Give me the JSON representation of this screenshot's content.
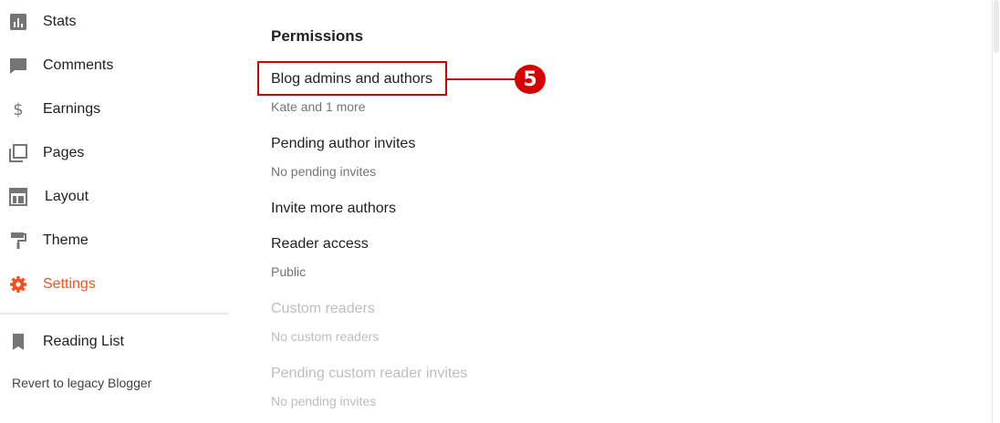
{
  "sidebar": {
    "items": [
      {
        "label": "Stats",
        "icon": "bar-chart-icon"
      },
      {
        "label": "Comments",
        "icon": "comment-icon"
      },
      {
        "label": "Earnings",
        "icon": "dollar-icon"
      },
      {
        "label": "Pages",
        "icon": "pages-icon"
      },
      {
        "label": "Layout",
        "icon": "layout-icon"
      },
      {
        "label": "Theme",
        "icon": "paint-roller-icon"
      },
      {
        "label": "Settings",
        "icon": "gear-icon",
        "active": true
      },
      {
        "label": "Reading List",
        "icon": "bookmark-icon"
      }
    ],
    "revert_label": "Revert to legacy Blogger",
    "active_color": "#f4511e",
    "icon_color": "#757575"
  },
  "permissions": {
    "title": "Permissions",
    "items": [
      {
        "title": "Blog admins and authors",
        "subtitle": "Kate and 1 more"
      },
      {
        "title": "Pending author invites",
        "subtitle": "No pending invites"
      },
      {
        "title": "Invite more authors"
      },
      {
        "title": "Reader access",
        "subtitle": "Public"
      },
      {
        "title": "Custom readers",
        "subtitle": "No custom readers",
        "disabled": true
      },
      {
        "title": "Pending custom reader invites",
        "subtitle": "No pending invites",
        "disabled": true
      }
    ]
  },
  "annotation": {
    "number": "5",
    "color": "#d50000"
  }
}
